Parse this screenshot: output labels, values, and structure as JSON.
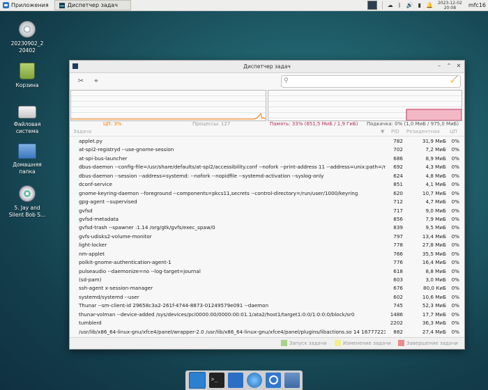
{
  "panel": {
    "apps_label": "Приложения",
    "task_label": "Диспетчер задач",
    "clock_date": "2023-12-02",
    "clock_time": "20:08",
    "hostname": "mfc16"
  },
  "desktop_icons": [
    {
      "label": "20230902_220402"
    },
    {
      "label": "Корзина"
    },
    {
      "label": "Файловая система"
    },
    {
      "label": "Домашняя папка"
    },
    {
      "label": "5. Jay and Silent Bob S..."
    }
  ],
  "window": {
    "title": "Диспетчер задач",
    "search_placeholder": "",
    "cpu_stat": "ЦП: 3%",
    "processes_stat": "Процессы: 127",
    "memory_stat": "Память: 33% (651,5 МиБ / 1,9 ГиБ)",
    "swap_stat": "Подкачка: 0% (1,0 МиБ / 975,0 МиБ)",
    "columns": {
      "task": "Задача",
      "pid": "PID",
      "rss": "Резидентная",
      "cpu": "ЦП"
    },
    "rows": [
      {
        "name": "applet.py",
        "pid": "782",
        "mem": "31,9 МиБ",
        "cpu": "0%"
      },
      {
        "name": "at-spi2-registryd --use-gnome-session",
        "pid": "702",
        "mem": "7,2 МиБ",
        "cpu": "0%"
      },
      {
        "name": "at-spi-bus-launcher",
        "pid": "686",
        "mem": "8,9 МиБ",
        "cpu": "0%"
      },
      {
        "name": "dbus-daemon --config-file=/usr/share/defaults/at-spi2/accessibility.conf --nofork --print-address 11 --address=unix:path=/r",
        "pid": "692",
        "mem": "4,3 МиБ",
        "cpu": "0%"
      },
      {
        "name": "dbus-daemon --session --address=systemd: --nofork --nopidfile --systemd-activation --syslog-only",
        "pid": "624",
        "mem": "4,8 МиБ",
        "cpu": "0%"
      },
      {
        "name": "dconf-service",
        "pid": "851",
        "mem": "4,1 МиБ",
        "cpu": "0%"
      },
      {
        "name": "gnome-keyring-daemon --foreground --components=pkcs11,secrets --control-directory=/run/user/1000/keyring",
        "pid": "620",
        "mem": "10,7 МиБ",
        "cpu": "0%"
      },
      {
        "name": "gpg-agent --supervised",
        "pid": "712",
        "mem": "4,7 МиБ",
        "cpu": "0%"
      },
      {
        "name": "gvfsd",
        "pid": "717",
        "mem": "9,0 МиБ",
        "cpu": "0%"
      },
      {
        "name": "gvfsd-metadata",
        "pid": "856",
        "mem": "7,9 МиБ",
        "cpu": "0%"
      },
      {
        "name": "gvfsd-trash --spawner :1.14 /org/gtk/gvfs/exec_spaw/0",
        "pid": "839",
        "mem": "9,5 МиБ",
        "cpu": "0%"
      },
      {
        "name": "gvfs-udisks2-volume-monitor",
        "pid": "797",
        "mem": "13,4 МиБ",
        "cpu": "0%"
      },
      {
        "name": "light-locker",
        "pid": "778",
        "mem": "27,8 МиБ",
        "cpu": "0%"
      },
      {
        "name": "nm-applet",
        "pid": "766",
        "mem": "35,5 МиБ",
        "cpu": "0%"
      },
      {
        "name": "polkit-gnome-authentication-agent-1",
        "pid": "776",
        "mem": "16,4 МиБ",
        "cpu": "0%"
      },
      {
        "name": "pulseaudio --daemonize=no --log-target=journal",
        "pid": "618",
        "mem": "8,8 МиБ",
        "cpu": "0%"
      },
      {
        "name": "(sd-pam)",
        "pid": "603",
        "mem": "3,0 МиБ",
        "cpu": "0%"
      },
      {
        "name": "ssh-agent x-session-manager",
        "pid": "676",
        "mem": "80,0 КиБ",
        "cpu": "0%"
      },
      {
        "name": "systemd/systemd --user",
        "pid": "602",
        "mem": "10,6 МиБ",
        "cpu": "0%"
      },
      {
        "name": "Thunar --sm-client-id 29658c3a2-261f-4744-8873-01249579e091 --daemon",
        "pid": "745",
        "mem": "52,3 МиБ",
        "cpu": "0%"
      },
      {
        "name": "thunar-volman --device-added /sys/devices/pci0000:00/0000:00:01.1/ata2/host1/target1:0:0/1:0:0:0/block/sr0",
        "pid": "1486",
        "mem": "17,7 МиБ",
        "cpu": "0%"
      },
      {
        "name": "tumblerd",
        "pid": "2202",
        "mem": "36,3 МиБ",
        "cpu": "0%"
      },
      {
        "name": "/usr/lib/x86_64-linux-gnu/xfce4/panel/wrapper-2.0 /usr/lib/x86_64-linux-gnu/xfce4/panel/plugins/libactions.so 14 16777223",
        "pid": "882",
        "mem": "27,4 МиБ",
        "cpu": "0%"
      }
    ],
    "legend": {
      "start": "Запуск задачи",
      "change": "Изменение задачи",
      "end": "Завершение задачи"
    },
    "colors": {
      "cpu": "#f57900",
      "memory": "#b0305a",
      "legend_start": "#a7d488",
      "legend_change": "#f5ee8c",
      "legend_end": "#e98b8b"
    }
  },
  "dock": {
    "items": [
      "show-desktop-icon",
      "terminal-icon",
      "text-editor-icon",
      "web-browser-icon",
      "app-finder-icon",
      "file-manager-icon"
    ]
  }
}
